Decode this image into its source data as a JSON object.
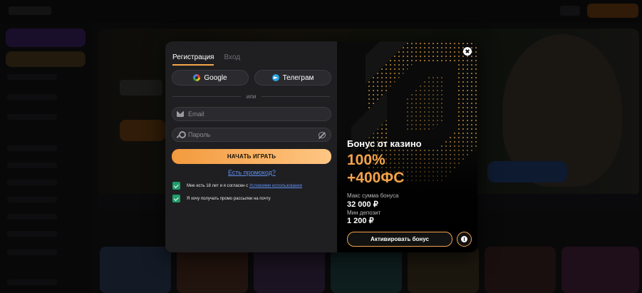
{
  "colors": {
    "accent_orange": "#f4a24b",
    "link_blue": "#5f8ff0",
    "checkbox_green": "#1f9d6a",
    "panel_bg": "#1f1f22"
  },
  "modal": {
    "tabs": [
      {
        "label": "Регистрация",
        "active": true
      },
      {
        "label": "Вход",
        "active": false
      }
    ],
    "social": {
      "google_label": "Google",
      "google_icon": "google-icon",
      "telegram_label": "Телеграм",
      "telegram_icon": "telegram-icon"
    },
    "divider_text": "или",
    "email_placeholder": "Email",
    "password_placeholder": "Пароль",
    "submit_label": "НАЧАТЬ ИГРАТЬ",
    "promo_link": "Есть промокод?",
    "consent_age_text": "Мне есть 18 лет и я согласен с ",
    "consent_age_link": "Условиями использования",
    "consent_age_checked": true,
    "consent_mailing_text": "Я хочу получать промо рассылки на почту",
    "consent_mailing_checked": true
  },
  "promo": {
    "title": "Бонус от казино",
    "percent": "100%",
    "free_spins": "+400ФС",
    "max_bonus_label": "Макс сумма бонуса",
    "max_bonus_value": "32 000 ₽",
    "min_deposit_label": "Мин депозит",
    "min_deposit_value": "1 200 ₽",
    "activate_label": "Активировать бонус"
  }
}
